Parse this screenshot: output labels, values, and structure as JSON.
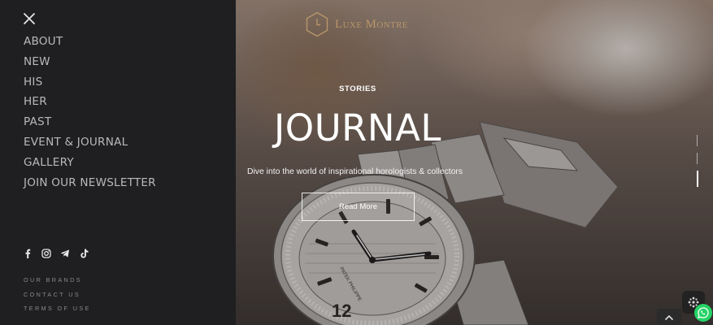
{
  "sidebar": {
    "menu": [
      {
        "label": "ABOUT"
      },
      {
        "label": "NEW"
      },
      {
        "label": "HIS"
      },
      {
        "label": "HER"
      },
      {
        "label": "PAST"
      },
      {
        "label": "EVENT & JOURNAL"
      },
      {
        "label": "GALLERY"
      },
      {
        "label": "JOIN OUR NEWSLETTER"
      }
    ],
    "social_icons": [
      "facebook-icon",
      "instagram-icon",
      "telegram-icon",
      "tiktok-icon"
    ],
    "footer_links": [
      {
        "label": "OUR BRANDS"
      },
      {
        "label": "CONTACT US"
      },
      {
        "label": "TERMS OF USE"
      }
    ]
  },
  "hero": {
    "brand": "Luxe Montre",
    "eyebrow": "STORIES",
    "title": "JOURNAL",
    "subtitle": "Dive into the world of inspirational horologists & collectors",
    "cta_label": "Read More",
    "watch_dial_text": "PATEK PHILIPPE",
    "watch_numeral": "12"
  },
  "colors": {
    "sidebar_bg": "#1f1f21",
    "menu_text": "#b9b9bc",
    "brand_gold": "#b7966a",
    "whatsapp_green": "#25d366"
  }
}
